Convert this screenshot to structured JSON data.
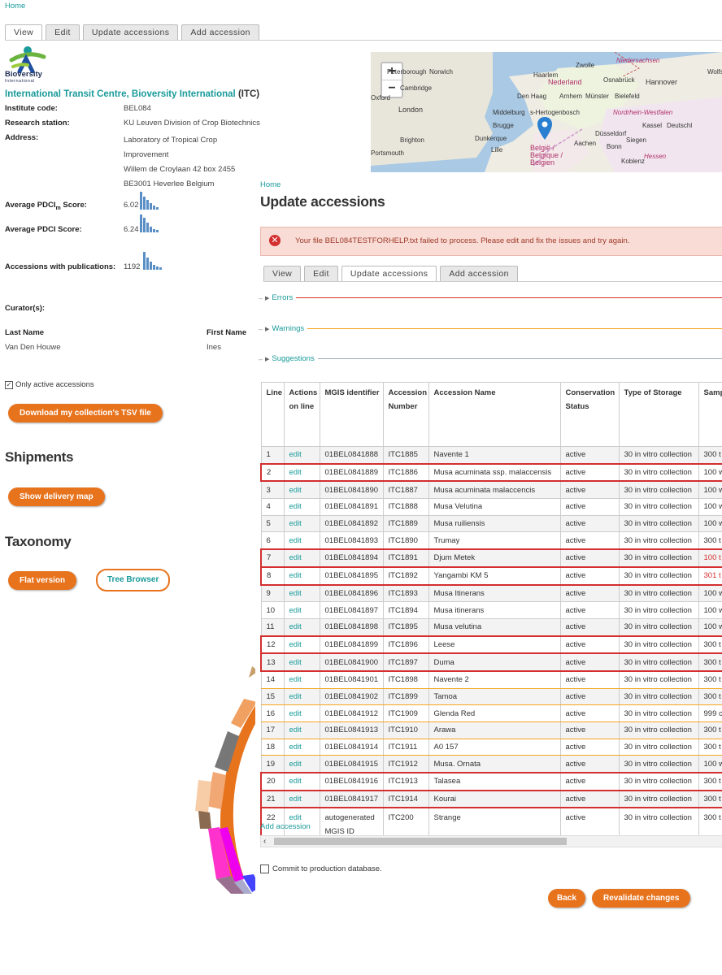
{
  "breadcrumb": "Home",
  "top_tabs": [
    "View",
    "Edit",
    "Update accessions",
    "Add accession"
  ],
  "logo": {
    "text": "Bioversity",
    "subtext": "International"
  },
  "institute": {
    "name": "International Transit Centre, Bioversity International",
    "acronym": "(ITC)",
    "code_label": "Institute code:",
    "code": "BEL084",
    "station_label": "Research station:",
    "station": "KU Leuven Division of Crop Biotechnics",
    "address_label": "Address:",
    "address_lines": [
      "Laboratory of Tropical Crop",
      "Improvement",
      "Willem de Croylaan 42 box 2455",
      "BE3001 Heverlee Belgium"
    ]
  },
  "scores": {
    "pdci_m_label": "Average PDCI",
    "pdci_m_sub": "m",
    "pdci_m_suffix": "Score:",
    "pdci_m_value": "6.02",
    "pdci_label": "Average PDCI Score:",
    "pdci_value": "6.24",
    "pubs_label": "Accessions with publications:",
    "pubs_value": "1192"
  },
  "curators": {
    "heading": "Curator(s):",
    "last_name_label": "Last Name",
    "first_name_label": "First Name",
    "last_name": "Van Den Houwe",
    "first_name": "Ines"
  },
  "only_active_label": "Only active accessions",
  "download_btn": "Download my collection's TSV file",
  "shipments": {
    "heading": "Shipments",
    "btn": "Show delivery map"
  },
  "taxonomy": {
    "heading": "Taxonomy",
    "flat_btn": "Flat version",
    "tree_btn": "Tree Browser"
  },
  "map": {
    "places": [
      {
        "name": "Norwich"
      },
      {
        "name": "Haarlem"
      },
      {
        "name": "Zwolle"
      },
      {
        "name": "Niedersachsen"
      },
      {
        "name": "Nederland"
      },
      {
        "name": "Osnabrück"
      },
      {
        "name": "Hannover"
      },
      {
        "name": "Cambridge"
      },
      {
        "name": "Den Haag"
      },
      {
        "name": "Arnhem"
      },
      {
        "name": "Münster"
      },
      {
        "name": "Bielefeld"
      },
      {
        "name": "London"
      },
      {
        "name": "Middelburg"
      },
      {
        "name": "s-Hertogenbosch"
      },
      {
        "name": "Brugge"
      },
      {
        "name": "Nordrhein-Westfalen"
      },
      {
        "name": "Kassel"
      },
      {
        "name": "Deutschl"
      },
      {
        "name": "Brighton"
      },
      {
        "name": "Dunkerque"
      },
      {
        "name": "Düsseldorf"
      },
      {
        "name": "Siegen"
      },
      {
        "name": "Aachen"
      },
      {
        "name": "Bonn"
      },
      {
        "name": "Lille"
      },
      {
        "name": "België / Belgique / Belgien"
      },
      {
        "name": "Koblenz"
      },
      {
        "name": "Hessen"
      },
      {
        "name": "Oxford"
      },
      {
        "name": "Portsmouth"
      },
      {
        "name": "Wolfsb"
      },
      {
        "name": "Peterborough"
      }
    ]
  },
  "overlay": {
    "breadcrumb": "Home",
    "title": "Update accessions",
    "error_message": "Your file BEL084TESTFORHELP.txt failed to process. Please edit and fix the issues and try again.",
    "tabs": [
      "View",
      "Edit",
      "Update accessions",
      "Add accession"
    ],
    "sections": {
      "errors": "Errors",
      "warnings": "Warnings",
      "suggestions": "Suggestions"
    },
    "columns": [
      "Line",
      "Actions on line",
      "MGIS identifier",
      "Accession Number",
      "Accession Name",
      "Conservation Status",
      "Type of Storage",
      "Samp"
    ],
    "rows": [
      {
        "line": "1",
        "action": "edit",
        "mgis": "01BEL0841888",
        "acc": "ITC1885",
        "name": "Navente 1",
        "status": "active",
        "storage": "30 in vitro collection",
        "samp": "300 t",
        "flag": ""
      },
      {
        "line": "2",
        "action": "edit",
        "mgis": "01BEL0841889",
        "acc": "ITC1886",
        "name": "Musa acuminata ssp. malaccensis",
        "status": "active",
        "storage": "30 in vitro collection",
        "samp": "100 w",
        "flag": "error"
      },
      {
        "line": "3",
        "action": "edit",
        "mgis": "01BEL0841890",
        "acc": "ITC1887",
        "name": "Musa acuminata malaccencis",
        "status": "active",
        "storage": "30 in vitro collection",
        "samp": "100 w",
        "flag": ""
      },
      {
        "line": "4",
        "action": "edit",
        "mgis": "01BEL0841891",
        "acc": "ITC1888",
        "name": "Musa Velutina",
        "status": "active",
        "storage": "30 in vitro collection",
        "samp": "100 w",
        "flag": ""
      },
      {
        "line": "5",
        "action": "edit",
        "mgis": "01BEL0841892",
        "acc": "ITC1889",
        "name": "Musa ruiliensis",
        "status": "active",
        "storage": "30 in vitro collection",
        "samp": "100 w",
        "flag": ""
      },
      {
        "line": "6",
        "action": "edit",
        "mgis": "01BEL0841893",
        "acc": "ITC1890",
        "name": "Trumay",
        "status": "active",
        "storage": "30 in vitro collection",
        "samp": "300 t",
        "flag": ""
      },
      {
        "line": "7",
        "action": "edit",
        "mgis": "01BEL0841894",
        "acc": "ITC1891",
        "name": "Djum Metek",
        "status": "active",
        "storage": "30 in vitro collection",
        "samp": "100 t",
        "flag": "error-red"
      },
      {
        "line": "8",
        "action": "edit",
        "mgis": "01BEL0841895",
        "acc": "ITC1892",
        "name": "Yangambi KM 5",
        "status": "active",
        "storage": "30 in vitro collection",
        "samp": "301 t",
        "flag": "error-red"
      },
      {
        "line": "9",
        "action": "edit",
        "mgis": "01BEL0841896",
        "acc": "ITC1893",
        "name": "Musa Itinerans",
        "status": "active",
        "storage": "30 in vitro collection",
        "samp": "100 w",
        "flag": ""
      },
      {
        "line": "10",
        "action": "edit",
        "mgis": "01BEL0841897",
        "acc": "ITC1894",
        "name": "Musa itinerans",
        "status": "active",
        "storage": "30 in vitro collection",
        "samp": "100 w",
        "flag": ""
      },
      {
        "line": "11",
        "action": "edit",
        "mgis": "01BEL0841898",
        "acc": "ITC1895",
        "name": "Musa velutina",
        "status": "active",
        "storage": "30 in vitro collection",
        "samp": "100 w",
        "flag": ""
      },
      {
        "line": "12",
        "action": "edit",
        "mgis": "01BEL0841899",
        "acc": "ITC1896",
        "name": "Leese",
        "status": "active",
        "storage": "30 in vitro collection",
        "samp": "300 t",
        "flag": "error"
      },
      {
        "line": "13",
        "action": "edit",
        "mgis": "01BEL0841900",
        "acc": "ITC1897",
        "name": "Duma",
        "status": "active",
        "storage": "30 in vitro collection",
        "samp": "300 t",
        "flag": "error"
      },
      {
        "line": "14",
        "action": "edit",
        "mgis": "01BEL0841901",
        "acc": "ITC1898",
        "name": "Navente 2",
        "status": "active",
        "storage": "30 in vitro collection",
        "samp": "300 t",
        "flag": "warn"
      },
      {
        "line": "15",
        "action": "edit",
        "mgis": "01BEL0841902",
        "acc": "ITC1899",
        "name": "Tamoa",
        "status": "active",
        "storage": "30 in vitro collection",
        "samp": "300 t",
        "flag": "warn"
      },
      {
        "line": "16",
        "action": "edit",
        "mgis": "01BEL0841912",
        "acc": "ITC1909",
        "name": "Glenda Red",
        "status": "active",
        "storage": "30 in vitro collection",
        "samp": "999 c",
        "flag": "warn"
      },
      {
        "line": "17",
        "action": "edit",
        "mgis": "01BEL0841913",
        "acc": "ITC1910",
        "name": "Arawa",
        "status": "active",
        "storage": "30 in vitro collection",
        "samp": "300 t",
        "flag": "warn"
      },
      {
        "line": "18",
        "action": "edit",
        "mgis": "01BEL0841914",
        "acc": "ITC1911",
        "name": "A0 157",
        "status": "active",
        "storage": "30 in vitro collection",
        "samp": "300 t",
        "flag": "warn"
      },
      {
        "line": "19",
        "action": "edit",
        "mgis": "01BEL0841915",
        "acc": "ITC1912",
        "name": "Musa. Ornata",
        "status": "active",
        "storage": "30 in vitro collection",
        "samp": "100 w",
        "flag": "warn"
      },
      {
        "line": "20",
        "action": "edit",
        "mgis": "01BEL0841916",
        "acc": "ITC1913",
        "name": "Talasea",
        "status": "active",
        "storage": "30 in vitro collection",
        "samp": "300 t",
        "flag": "error"
      },
      {
        "line": "21",
        "action": "edit",
        "mgis": "01BEL0841917",
        "acc": "ITC1914",
        "name": "Kourai",
        "status": "active",
        "storage": "30 in vitro collection",
        "samp": "300 t",
        "flag": "error"
      },
      {
        "line": "22",
        "action": "edit",
        "mgis": "autogenerated MGIS ID",
        "acc": "ITC200",
        "name": "Strange",
        "status": "active",
        "storage": "30 in vitro collection",
        "samp": "300 t",
        "flag": "error"
      }
    ],
    "add_accession": "Add accession",
    "commit_label": "Commit to production database.",
    "back_btn": "Back",
    "revalidate_btn": "Revalidate changes"
  },
  "colors": {
    "accent": "#e8731d",
    "link": "#1a9a9a",
    "error": "#d32f2f",
    "warning": "#f5a623",
    "suggestion": "#9ea7b3"
  }
}
